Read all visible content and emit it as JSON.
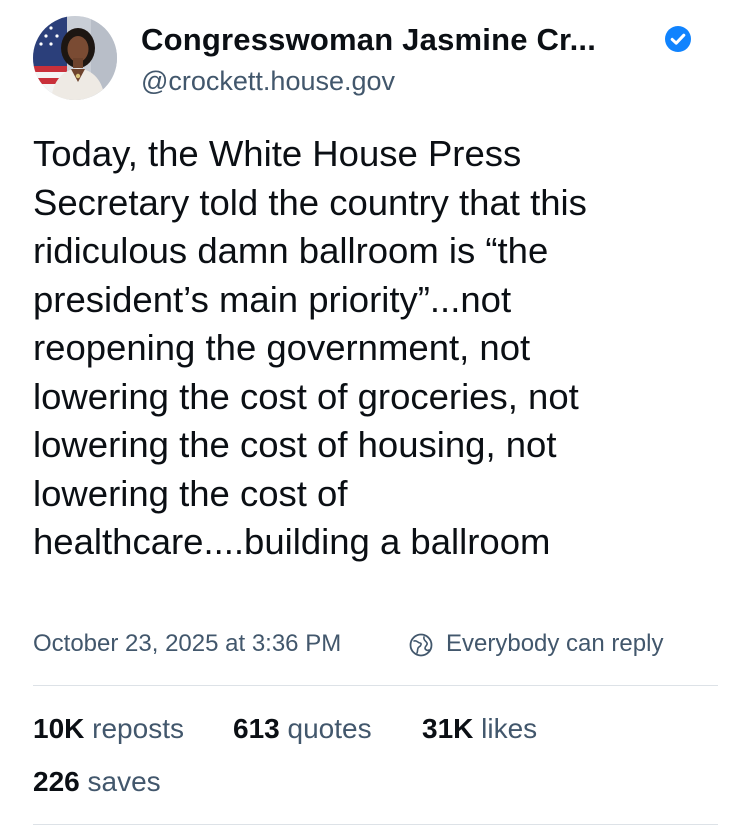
{
  "author": {
    "display_name": "Congresswoman Jasmine Cr...",
    "handle": "@crockett.house.gov",
    "verified_icon": "verified-badge-icon",
    "verified_color": "#1083fe",
    "avatar_icon": "profile-photo-avatar"
  },
  "post": {
    "lines": [
      "Today, the White House Press",
      "Secretary told the country that this",
      "ridiculous damn ballroom is “the",
      "president’s main priority”...not",
      "reopening the government, not",
      "lowering the cost of groceries, not",
      "lowering the cost of housing, not",
      "lowering the cost of",
      "healthcare....building a ballroom"
    ]
  },
  "meta": {
    "timestamp": "October 23, 2025 at 3:36 PM",
    "reply_icon": "globe-icon",
    "reply_setting": "Everybody can reply"
  },
  "stats": {
    "reposts": {
      "count": "10K",
      "label": "reposts"
    },
    "quotes": {
      "count": "613",
      "label": "quotes"
    },
    "likes": {
      "count": "31K",
      "label": "likes"
    },
    "saves": {
      "count": "226",
      "label": "saves"
    }
  },
  "colors": {
    "text_primary": "#0b0f14",
    "text_secondary": "#42576c",
    "divider": "#dde2e7"
  }
}
